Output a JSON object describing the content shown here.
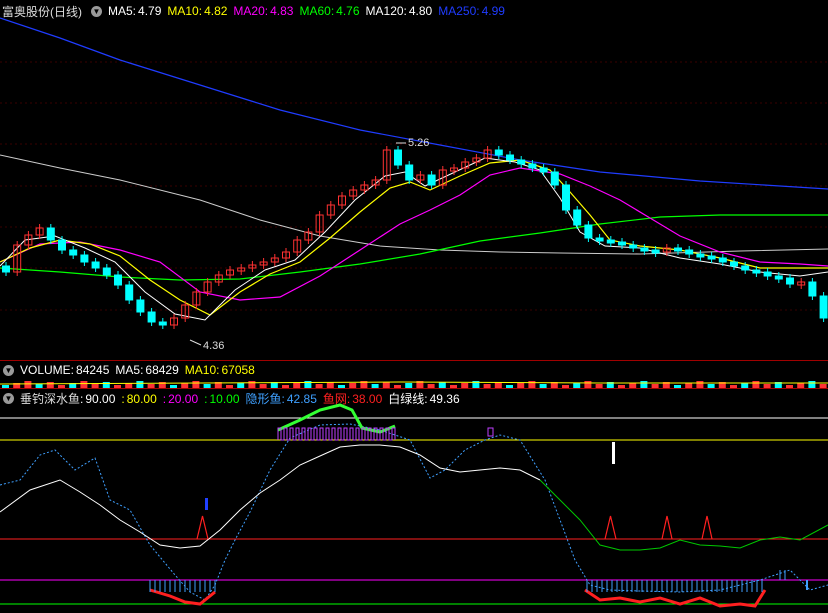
{
  "price_header": {
    "title": "富奥股份(日线)",
    "items": [
      {
        "label": "MA5:",
        "value": "4.79",
        "color": "#ffffff"
      },
      {
        "label": "MA10:",
        "value": "4.82",
        "color": "#ffff00"
      },
      {
        "label": "MA20:",
        "value": "4.83",
        "color": "#ff00ff"
      },
      {
        "label": "MA60:",
        "value": "4.76",
        "color": "#00ff00"
      },
      {
        "label": "MA120:",
        "value": "4.80",
        "color": "#ffffff"
      },
      {
        "label": "MA250:",
        "value": "4.99",
        "color": "#1f3cff"
      }
    ]
  },
  "price_annotations": {
    "high": "5.26",
    "low": "4.36"
  },
  "volume_header": {
    "items": [
      {
        "label": "VOLUME:",
        "value": "84245",
        "color": "#ffffff"
      },
      {
        "label": "MA5:",
        "value": "68429",
        "color": "#ffffff"
      },
      {
        "label": "MA10:",
        "value": "67058",
        "color": "#ffff00"
      }
    ]
  },
  "indicator_header": {
    "title": "垂钓深水鱼",
    "items": [
      {
        "label": ":",
        "value": "90.00",
        "color": "#ffffff"
      },
      {
        "label": ":",
        "value": "80.00",
        "color": "#ffff00"
      },
      {
        "label": ":",
        "value": "20.00",
        "color": "#ff00ff"
      },
      {
        "label": ":",
        "value": "10.00",
        "color": "#00ff00"
      },
      {
        "label": "隐形鱼:",
        "value": "42.85",
        "color": "#3fa0ff"
      },
      {
        "label": "鱼网:",
        "value": "38.00",
        "color": "#ff2020"
      },
      {
        "label": "白绿线:",
        "value": "49.36",
        "color": "#ffffff"
      }
    ]
  },
  "colors": {
    "up": "#ff3232",
    "down": "#00ffff",
    "ma5": "#ffffff",
    "ma10": "#ffff00",
    "ma20": "#ff00ff",
    "ma60": "#00ff00",
    "ma120": "#cccccc",
    "ma250": "#1f3cff"
  },
  "icons": {
    "header_toggle": "chevron-down-icon"
  }
}
